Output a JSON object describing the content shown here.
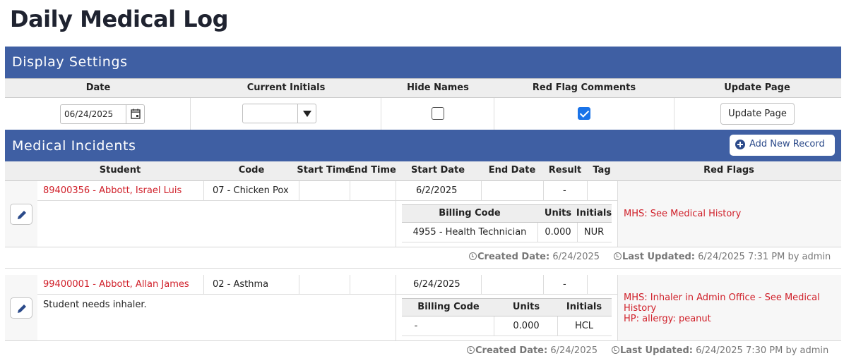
{
  "page": {
    "title": "Daily Medical Log"
  },
  "display_settings": {
    "title": "Display Settings",
    "headers": {
      "date": "Date",
      "initials": "Current Initials",
      "hide_names": "Hide Names",
      "red_flag": "Red Flag Comments",
      "update": "Update Page"
    },
    "date_value": "06/24/2025",
    "initials_value": "",
    "hide_names_checked": false,
    "red_flag_checked": true,
    "update_button_label": "Update Page"
  },
  "medical_incidents": {
    "title": "Medical Incidents",
    "add_button_label": "Add New Record",
    "columns": [
      "Student",
      "Code",
      "Start Time",
      "End Time",
      "Start Date",
      "End Date",
      "Result",
      "Tag",
      "Red Flags"
    ],
    "billing_headers": [
      "Billing Code",
      "Units",
      "Initials"
    ],
    "records": [
      {
        "student": "89400356 - Abbott, Israel Luis",
        "code": "07 - Chicken Pox",
        "start_time": "",
        "end_time": "",
        "start_date": "6/2/2025",
        "end_date": "",
        "result": "-",
        "tag": "",
        "comment": "",
        "billing": {
          "code": "4955 - Health Technician",
          "units": "0.000",
          "initials": "NUR"
        },
        "red_flags": [
          "MHS: See Medical History"
        ],
        "created_label": "Created Date:",
        "created_value": "6/24/2025",
        "updated_label": "Last Updated:",
        "updated_value": "6/24/2025 7:31 PM by admin"
      },
      {
        "student": "99400001 - Abbott, Allan James",
        "code": "02 - Asthma",
        "start_time": "",
        "end_time": "",
        "start_date": "6/24/2025",
        "end_date": "",
        "result": "-",
        "tag": "",
        "comment": "Student needs inhaler.",
        "billing": {
          "code": "-",
          "units": "0.000",
          "initials": "HCL"
        },
        "red_flags": [
          "MHS: Inhaler in Admin Office - See Medical History",
          "HP: allergy: peanut"
        ],
        "created_label": "Created Date:",
        "created_value": "6/24/2025",
        "updated_label": "Last Updated:",
        "updated_value": "6/24/2025 7:30 PM by admin"
      }
    ]
  },
  "icons": {
    "calendar": "calendar-icon",
    "dropdown": "chevron-down-icon",
    "add": "plus-circle-icon",
    "edit": "pencil-icon",
    "clock": "clock-icon"
  }
}
